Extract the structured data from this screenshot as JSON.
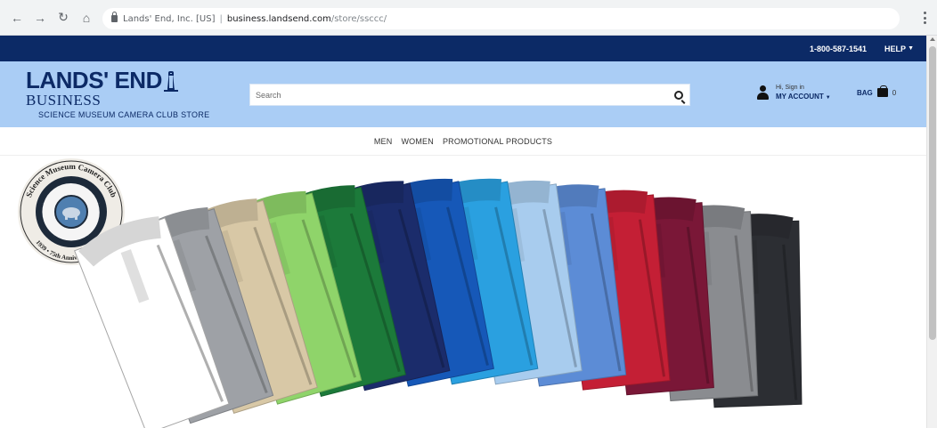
{
  "browser": {
    "url_title": "Lands' End, Inc. [US]",
    "url_host": "business.landsend.com",
    "url_path": "/store/ssccc/"
  },
  "utility": {
    "phone": "1-800-587-1541",
    "help_label": "HELP"
  },
  "header": {
    "logo_main": "LANDS' END",
    "logo_sub": "BUSINESS",
    "store_name": "SCIENCE MUSEUM CAMERA CLUB STORE",
    "search_placeholder": "Search",
    "account_greeting": "Hi, Sign in",
    "account_label": "MY ACCOUNT",
    "bag_label": "BAG",
    "bag_count": "0"
  },
  "nav": {
    "items": [
      "MEN",
      "WOMEN",
      "PROMOTIONAL PRODUCTS"
    ]
  },
  "hero": {
    "badge_top": "Science Museum Camera Club",
    "badge_years": "1939 • 75th Anniversary • 2014",
    "shirt_colors": [
      "#ffffff",
      "#9ea1a6",
      "#d8c8a6",
      "#8fd46a",
      "#1c7a3a",
      "#1b2c6b",
      "#1658b8",
      "#2aa0e0",
      "#a8ccee",
      "#5c8cd6",
      "#c41f35",
      "#7a1737",
      "#8a8c90",
      "#2c2e33"
    ]
  }
}
